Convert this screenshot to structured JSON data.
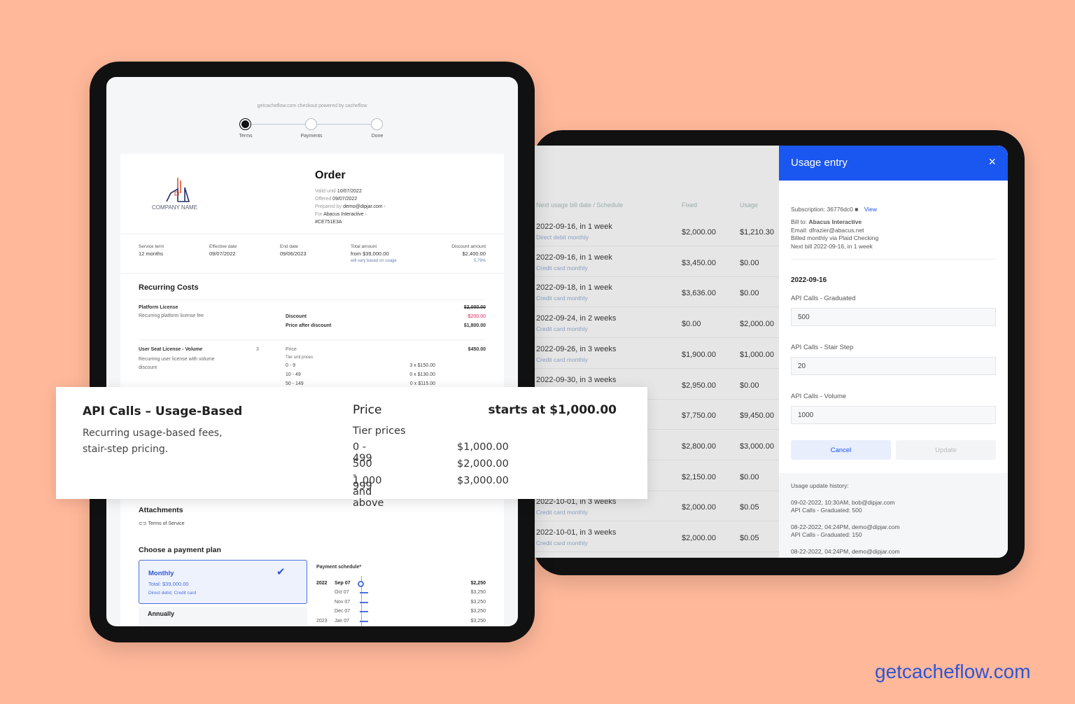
{
  "brand": {
    "url": "getcacheflow.com",
    "accent": "#1a56f0",
    "background": "#ffb89a"
  },
  "table": {
    "headers": [
      "Next usage bill date / Schedule",
      "Fixed",
      "Usage"
    ],
    "rows": [
      {
        "date": "2022-09-16, in 1 week",
        "schedule": "Direct debit monthly",
        "fixed": "$2,000.00",
        "usage": "$1,210.30"
      },
      {
        "date": "2022-09-16, in 1 week",
        "schedule": "Credit card monthly",
        "fixed": "$3,450.00",
        "usage": "$0.00"
      },
      {
        "date": "2022-09-18, in 1 week",
        "schedule": "Credit card monthly",
        "fixed": "$3,636.00",
        "usage": "$0.00"
      },
      {
        "date": "2022-09-24, in 2 weeks",
        "schedule": "Credit card monthly",
        "fixed": "$0.00",
        "usage": "$2,000.00"
      },
      {
        "date": "2022-09-26, in 3 weeks",
        "schedule": "Credit card monthly",
        "fixed": "$1,900.00",
        "usage": "$1,000.00"
      },
      {
        "date": "2022-09-30, in 3 weeks",
        "schedule": "",
        "fixed": "$2,950.00",
        "usage": "$0.00"
      },
      {
        "date": "",
        "schedule": "",
        "fixed": "$7,750.00",
        "usage": "$9,450.00"
      },
      {
        "date": "",
        "schedule": "",
        "fixed": "$2,800.00",
        "usage": "$3,000.00"
      },
      {
        "date": "",
        "schedule": "",
        "fixed": "$2,150.00",
        "usage": "$0.00"
      },
      {
        "date": "2022-10-01, in 3 weeks",
        "schedule": "Credit card monthly",
        "fixed": "$2,000.00",
        "usage": "$0.05"
      },
      {
        "date": "2022-10-01, in 3 weeks",
        "schedule": "Credit card monthly",
        "fixed": "$2,000.00",
        "usage": "$0.05"
      }
    ]
  },
  "usage_panel": {
    "title": "Usage entry",
    "subscription_label": "Subscription:",
    "subscription_id": "36776dc0",
    "view": "View",
    "bill_to_label": "Bill to:",
    "bill_to": "Abacus Interactive",
    "email": "Email: dfrazier@abacus.net",
    "billed": "Billed monthly via Plaid Checking",
    "next_bill": "Next bill 2022-09-16, in 1 week",
    "date": "2022-09-16",
    "fields": [
      {
        "label": "API Calls - Graduated",
        "value": "500"
      },
      {
        "label": "API Calls - Stair Step",
        "value": "20"
      },
      {
        "label": "API Calls - Volume",
        "value": "1000"
      }
    ],
    "cancel": "Cancel",
    "update": "Update",
    "history_title": "Usage update history:",
    "history": [
      {
        "who": "09-02-2022, 10:30AM, bob@dipjar.com",
        "what": "API Calls - Graduated: 500"
      },
      {
        "who": "08-22-2022, 04:24PM, demo@dipjar.com",
        "what": "API Calls - Graduated: 150"
      },
      {
        "who": "08-22-2022, 04:24PM, demo@dipjar.com",
        "what": ""
      }
    ]
  },
  "checkout": {
    "powered": "getcacheflow.com checkout powered by cacheflow",
    "steps": [
      "Terms",
      "Payments",
      "Done"
    ],
    "company": "COMPANY NAME",
    "title": "Order",
    "valid_label": "Valid until",
    "valid": "10/07/2022",
    "offered_label": "Offered",
    "offered": "09/07/2022",
    "prepared_label": "Prepared by",
    "prepared": "demo@dipjar.com",
    "for_label": "For",
    "for": "Abacus Interactive",
    "id": "#CE751E3A",
    "summary": [
      {
        "label": "Service term",
        "value": "12 months",
        "note": ""
      },
      {
        "label": "Effective date",
        "value": "09/07/2022",
        "note": ""
      },
      {
        "label": "End date",
        "value": "09/06/2023",
        "note": ""
      },
      {
        "label": "Total amount",
        "value": "from $39,000.00",
        "note": "will vary based on usage"
      },
      {
        "label": "Discount amount",
        "value": "$2,400.00",
        "note": "5.79%"
      }
    ],
    "recurring_title": "Recurring Costs",
    "platform": {
      "name": "Platform License",
      "desc": "Recurring platform license fee",
      "price": "$2,000.00",
      "discount_label": "Discount",
      "discount": "-$200.00",
      "after_label": "Price after discount",
      "after": "$1,800.00"
    },
    "seat": {
      "name": "User Seat License - Volume",
      "desc": "Recurring user license with volume discount",
      "qty": "3",
      "price_label": "Price",
      "price": "$450.00",
      "tier_label": "Tier unit prices",
      "tiers": [
        [
          "0 - 9",
          "3 x $150.00"
        ],
        [
          "10 - 49",
          "0 x $130.00"
        ],
        [
          "50 - 149",
          "0 x $115.00"
        ]
      ]
    },
    "attachments_title": "Attachments",
    "attachment": "Terms of Service",
    "plan_title": "Choose a payment plan",
    "plan": {
      "name": "Monthly",
      "total": "Total: $39,000.00",
      "methods": "Direct debit, Credit card"
    },
    "plan2": "Annually",
    "schedule_title": "Payment schedule*",
    "schedule": [
      [
        "2022",
        "Sep 07",
        "$2,250"
      ],
      [
        "",
        "Oct 07",
        "$3,250"
      ],
      [
        "",
        "Nov 07",
        "$3,250"
      ],
      [
        "",
        "Dec 07",
        "$3,250"
      ],
      [
        "2023",
        "Jan 07",
        "$3,250"
      ]
    ]
  },
  "api_card": {
    "name": "API Calls – Usage-Based",
    "desc1": "Recurring usage-based fees,",
    "desc2": "stair-step pricing.",
    "price_label": "Price",
    "price": "starts at $1,000.00",
    "tier_label": "Tier prices",
    "tiers": [
      [
        "0 - 499",
        "$1,000.00"
      ],
      [
        "500 - 999",
        "$2,000.00"
      ],
      [
        "1,000 and above",
        "$3,000.00"
      ]
    ]
  }
}
